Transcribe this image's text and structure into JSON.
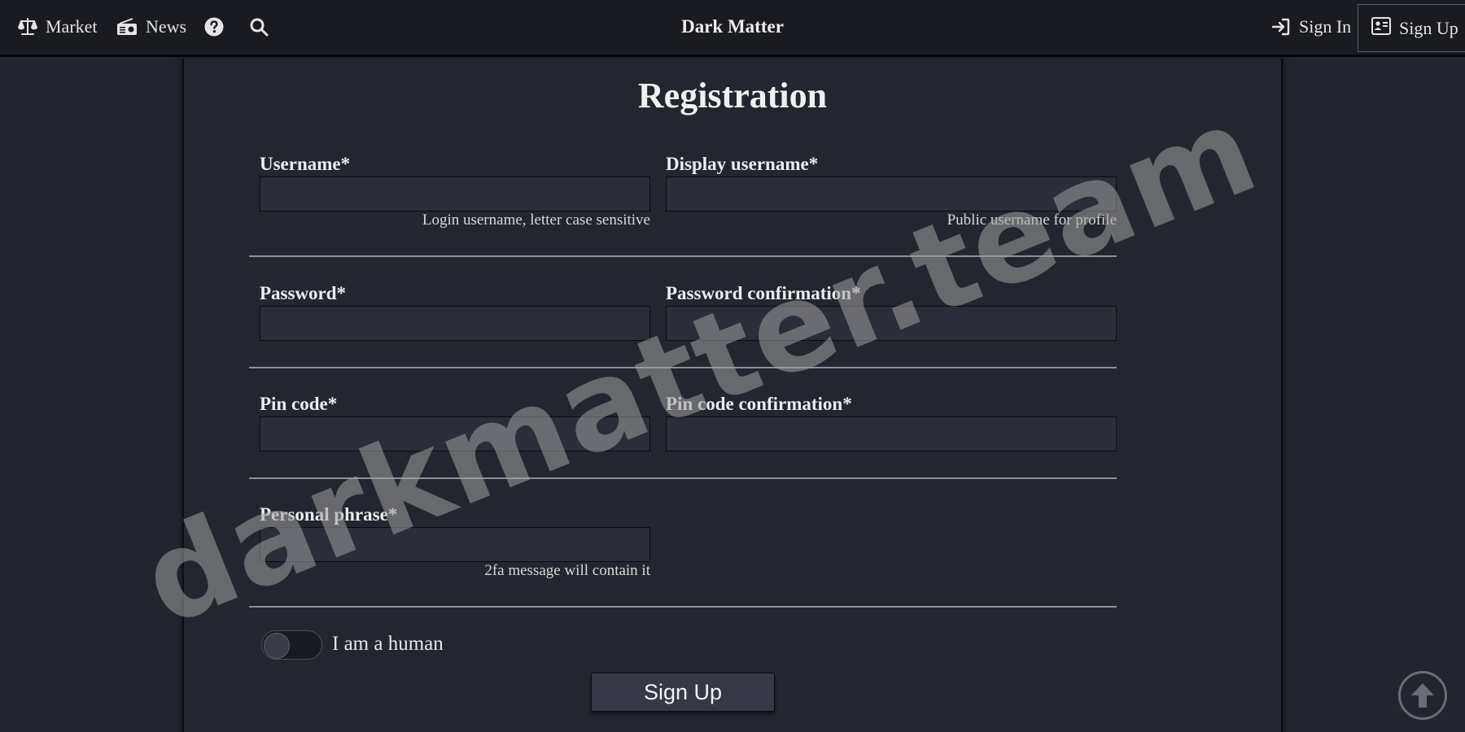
{
  "nav": {
    "market_label": "Market",
    "news_label": "News",
    "brand": "Dark Matter",
    "sign_in_label": "Sign In",
    "sign_up_label": "Sign Up"
  },
  "form": {
    "title": "Registration",
    "username": {
      "label": "Username*",
      "value": "",
      "hint": "Login username, letter case sensitive"
    },
    "display_username": {
      "label": "Display username*",
      "value": "",
      "hint": "Public username for profile"
    },
    "password": {
      "label": "Password*",
      "value": ""
    },
    "password_confirmation": {
      "label": "Password confirmation*",
      "value": ""
    },
    "pin_code": {
      "label": "Pin code*",
      "value": ""
    },
    "pin_code_confirmation": {
      "label": "Pin code confirmation*",
      "value": ""
    },
    "personal_phrase": {
      "label": "Personal phrase*",
      "value": "",
      "hint": "2fa message will contain it"
    },
    "human_toggle_label": "I am a human",
    "submit_label": "Sign Up"
  },
  "watermark": "darkmatter.team",
  "icons": {
    "market": "scale-icon",
    "news": "radio-icon",
    "help": "question-circle-icon",
    "search": "search-icon",
    "sign_in": "sign-in-icon",
    "sign_up": "id-card-icon",
    "scroll_top": "arrow-up-circle-icon"
  },
  "colors": {
    "background": "#22252e",
    "navbar": "#191b21",
    "panel": "#23262f",
    "input": "#2b2e38",
    "button": "#363945"
  }
}
